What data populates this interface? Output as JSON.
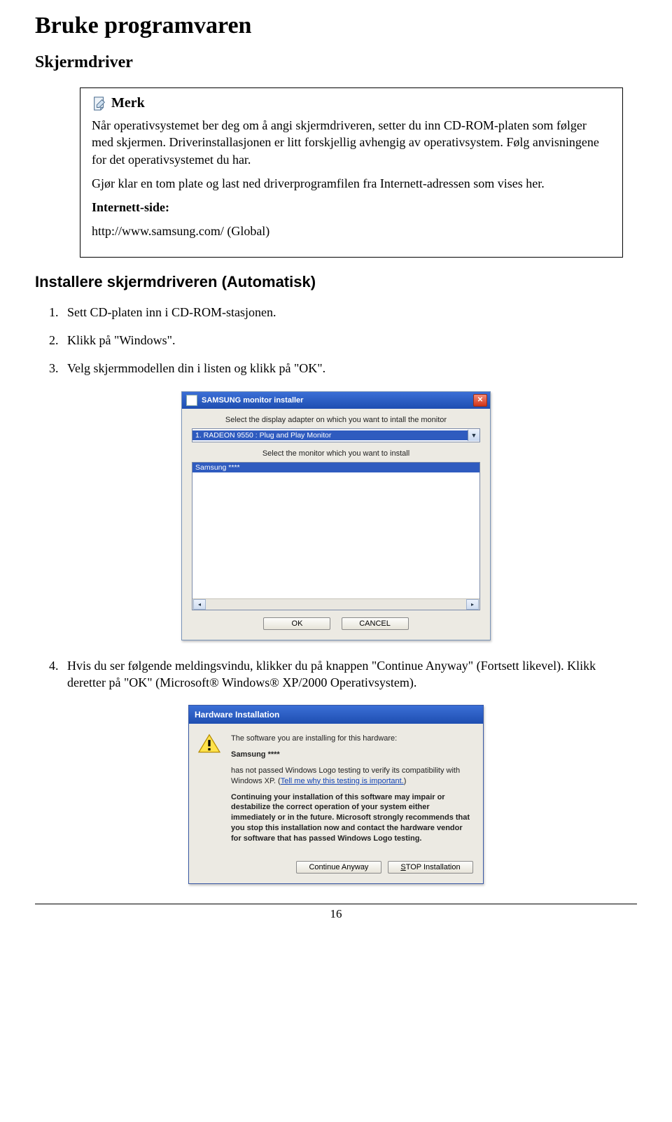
{
  "title": "Bruke programvaren",
  "subtitle": "Skjermdriver",
  "note": {
    "label": "Merk",
    "p1": "Når operativsystemet ber deg om å angi skjermdriveren, setter du inn CD-ROM-platen som følger med skjermen. Driverinstallasjonen er litt forskjellig avhengig av operativsystem. Følg anvisningene for det operativsystemet du har.",
    "p2": "Gjør klar en tom plate og last ned driverprogramfilen fra Internett-adressen som vises her.",
    "label2": "Internett-side:",
    "url": "http://www.samsung.com/ (Global)"
  },
  "section": "Installere skjermdriveren (Automatisk)",
  "steps": [
    "Sett CD-platen inn i CD-ROM-stasjonen.",
    "Klikk på \"Windows\".",
    "Velg skjermmodellen din i listen og klikk på \"OK\"."
  ],
  "installer": {
    "title": "SAMSUNG monitor installer",
    "instr1": "Select the display adapter on which you want to intall the monitor",
    "combo": "1. RADEON 9550 : Plug and Play Monitor",
    "instr2": "Select the monitor which you want to install",
    "list_selected": "Samsung ****",
    "ok": "OK",
    "cancel": "CANCEL"
  },
  "step4": "Hvis du ser følgende meldingsvindu, klikker du på knappen \"Continue Anyway\" (Fortsett likevel). Klikk deretter på \"OK\" (Microsoft® Windows® XP/2000 Operativsystem).",
  "hw": {
    "title": "Hardware Installation",
    "line1": "The software you are installing for this hardware:",
    "device": "Samsung ****",
    "line2a": "has not passed Windows Logo testing to verify its compatibility with Windows XP. (",
    "link": "Tell me why this testing is important.",
    "line2b": ")",
    "bold_para": "Continuing your installation of this software may impair or destabilize the correct operation of your system either immediately or in the future. Microsoft strongly recommends that you stop this installation now and contact the hardware vendor for software that has passed Windows Logo testing.",
    "btn_continue": "Continue Anyway",
    "btn_stop": "STOP Installation"
  },
  "page_number": "16"
}
